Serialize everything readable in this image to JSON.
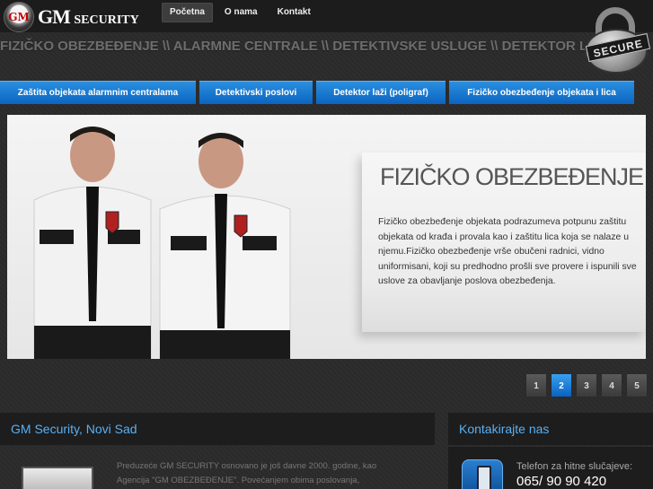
{
  "header": {
    "logo_badge": "GM",
    "logo_main": "GM",
    "logo_sub": "SECURITY",
    "nav": [
      {
        "label": "Početna",
        "active": true
      },
      {
        "label": "O nama",
        "active": false
      },
      {
        "label": "Kontakt",
        "active": false
      }
    ]
  },
  "ticker": "FIZIČKO OBEZBEĐENJE \\\\ ALARMNE CENTRALE \\\\ DETEKTIVSKE USLUGE \\\\ DETEKTOR LAŽI (PO",
  "badge": {
    "label": "SECURE"
  },
  "menu": [
    {
      "label": "Zaštita objekata alarmnim centralama"
    },
    {
      "label": "Detektivski poslovi"
    },
    {
      "label": "Detektor laži (poligraf)"
    },
    {
      "label": "Fizičko obezbeđenje objekata i lica"
    }
  ],
  "slide": {
    "title": "FIZIČKO OBEZBEĐENJE",
    "text": "Fizičko obezbeđenje objekata podrazumeva potpunu zaštitu objekata od krađa i provala kao i zaštitu lica koja se nalaze u njemu.Fizičko obezbeđenje vrše obučeni radnici, vidno uniformisani, koji su predhodno prošli sve provere i ispunili sve uslove za obavljanje poslova obezbeđenja."
  },
  "pager": [
    "1",
    "2",
    "3",
    "4",
    "5"
  ],
  "pager_active": 1,
  "about": {
    "title": "GM Security, Novi Sad",
    "text": "Preduzeće GM SECURITY osnovano je još davne 2000. godine, kao Agencija \"GM OBEZBEĐENJE\". Povećanjem obima poslovanja, Agencija"
  },
  "contact": {
    "title": "Kontakirajte nas",
    "label": "Telefon za hitne slučajeve:",
    "phone": "065/ 90 90 420"
  },
  "colors": {
    "accent": "#1a7ad4",
    "heading": "#5ab0f4"
  }
}
